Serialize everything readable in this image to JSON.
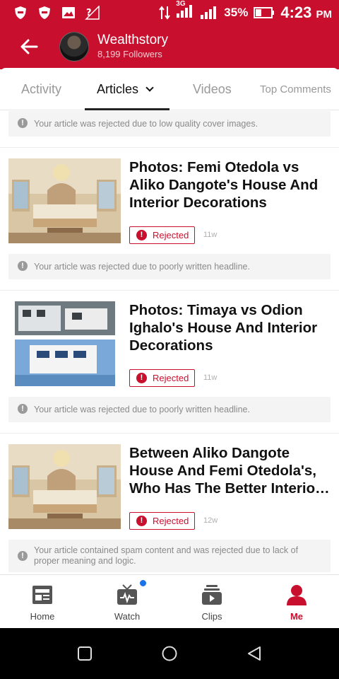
{
  "status_bar": {
    "network": "3G",
    "battery": "35%",
    "time": "4:23",
    "ampm": "PM",
    "icons": [
      "shield-icon",
      "shield-icon",
      "image-icon",
      "no-signal-icon",
      "data-arrows-icon",
      "signal-icon",
      "signal-icon",
      "battery-icon"
    ]
  },
  "header": {
    "back_icon": "arrow-left-icon",
    "name": "Wealthstory",
    "followers": "8,199 Followers"
  },
  "tabs": [
    {
      "label": "Activity"
    },
    {
      "label": "Articles"
    },
    {
      "label": "Videos"
    },
    {
      "label": "Top Comments"
    }
  ],
  "feed": {
    "top_notice": "Your article was rejected due to low quality cover images.",
    "articles": [
      {
        "title": "Photos: Femi Otedola vs Aliko Dangote's House And Interior Decorations",
        "status": "Rejected",
        "age": "11w",
        "reason": "Your article was rejected due to poorly written headline."
      },
      {
        "title": "Photos: Timaya vs Odion Ighalo's House And Interior Decorations",
        "status": "Rejected",
        "age": "11w",
        "reason": "Your article was rejected due to poorly written headline."
      },
      {
        "title": "Between Aliko Dangote House And Femi Otedola's, Who Has The Better Interior Decorations?",
        "status": "Rejected",
        "age": "12w",
        "reason": "Your article contained spam content and was rejected due to lack of proper meaning and logic."
      }
    ]
  },
  "bottom_nav": [
    {
      "label": "Home",
      "icon": "newspaper-icon"
    },
    {
      "label": "Watch",
      "icon": "tv-icon"
    },
    {
      "label": "Clips",
      "icon": "clips-icon"
    },
    {
      "label": "Me",
      "icon": "person-icon"
    }
  ],
  "colors": {
    "brand": "#c8102e",
    "notification_dot": "#1a73e8"
  }
}
